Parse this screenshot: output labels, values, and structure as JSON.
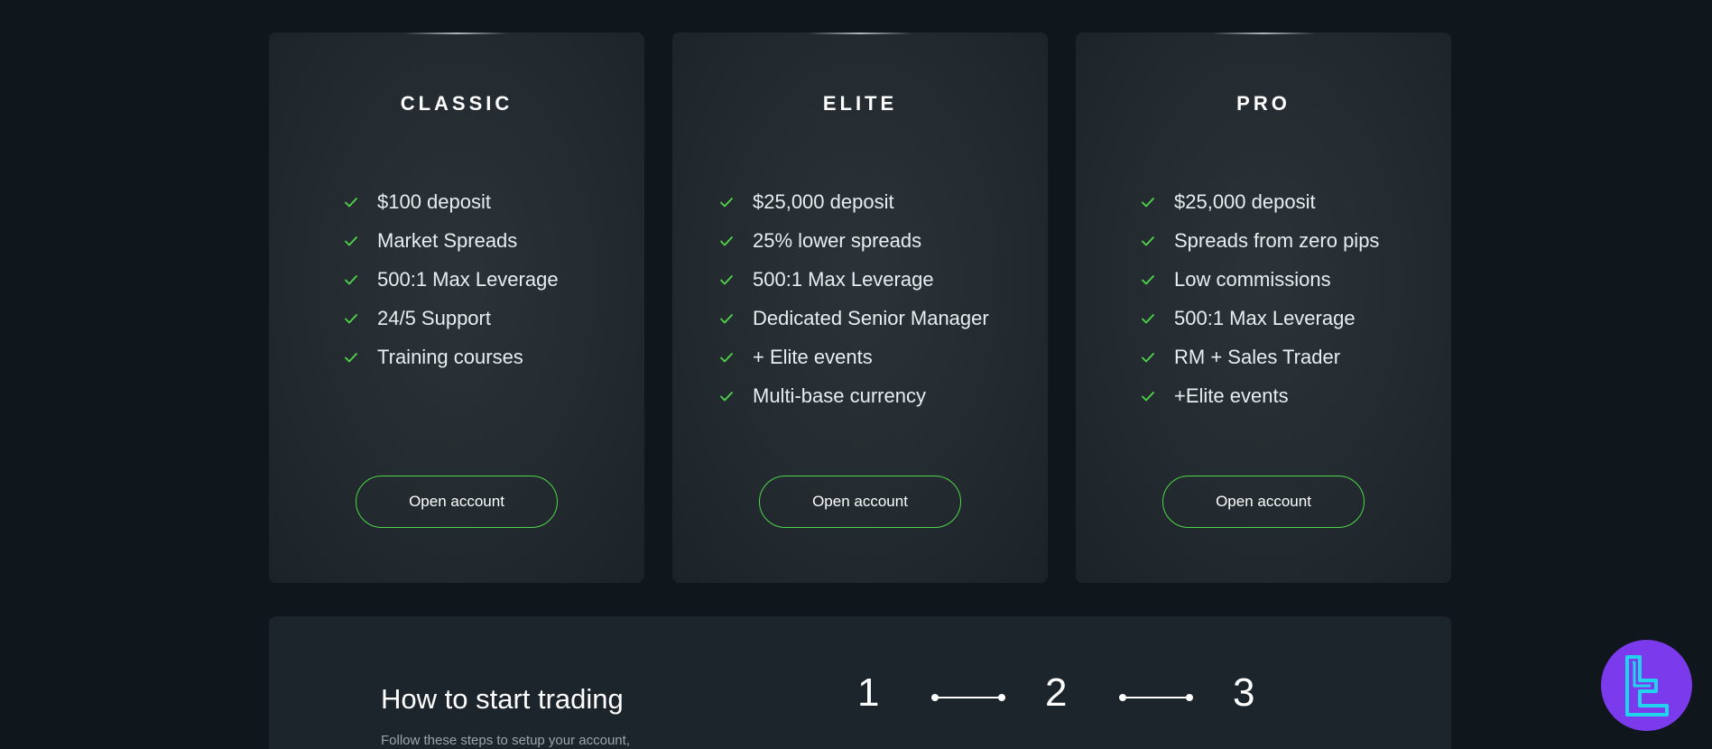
{
  "plans": [
    {
      "name": "CLASSIC",
      "features": [
        "$100 deposit",
        "Market Spreads",
        "500:1 Max Leverage",
        "24/5 Support",
        "Training courses"
      ],
      "cta": "Open account"
    },
    {
      "name": "ELITE",
      "features": [
        "$25,000 deposit",
        "25% lower spreads",
        "500:1 Max Leverage",
        "Dedicated Senior Manager",
        "+ Elite events",
        "Multi-base currency"
      ],
      "cta": "Open account"
    },
    {
      "name": "PRO",
      "features": [
        "$25,000 deposit",
        "Spreads from zero pips",
        "Low commissions",
        "500:1 Max Leverage",
        "RM + Sales Trader",
        "+Elite events"
      ],
      "cta": "Open account"
    }
  ],
  "start": {
    "title": "How to start trading",
    "subtitle": "Follow these steps to setup your account,",
    "steps": [
      "1",
      "2",
      "3"
    ]
  },
  "icons": {
    "feature": "check-icon",
    "badge": "brand-logo-icon"
  },
  "colors": {
    "accent": "#4fd64a",
    "background": "#0f161c",
    "card": "#232b30",
    "badge": "#7c3aed",
    "logo": "#22d3ee"
  }
}
